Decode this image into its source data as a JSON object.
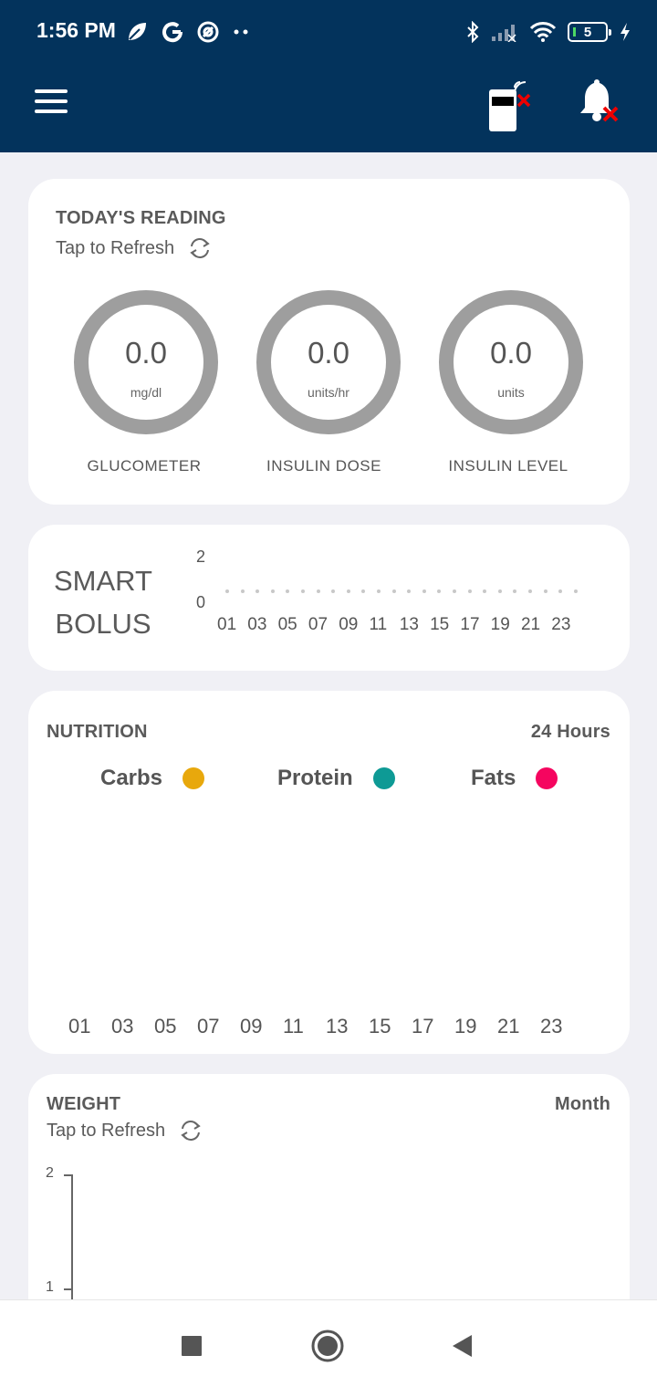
{
  "status_bar": {
    "time": "1:56 PM",
    "battery_level": "5",
    "icons_left": [
      "leaf-icon",
      "google-icon",
      "at-icon",
      "dots-icon"
    ],
    "icons_right": [
      "bluetooth-icon",
      "signal-icon",
      "wifi-icon",
      "battery-icon",
      "charging-icon"
    ]
  },
  "app_bar": {
    "icons": [
      "menu-icon",
      "device-disconnected-icon",
      "bell-off-icon"
    ]
  },
  "todays_reading": {
    "title": "TODAY'S READING",
    "refresh_label": "Tap to Refresh",
    "gauges": [
      {
        "value": "0.0",
        "unit": "mg/dl",
        "label": "GLUCOMETER"
      },
      {
        "value": "0.0",
        "unit": "units/hr",
        "label": "INSULIN DOSE"
      },
      {
        "value": "0.0",
        "unit": "units",
        "label": "INSULIN LEVEL"
      }
    ]
  },
  "smart_bolus": {
    "title_line1": "SMART",
    "title_line2": "BOLUS",
    "y_ticks": [
      "2",
      "0"
    ],
    "x_ticks": [
      "01",
      "03",
      "05",
      "07",
      "09",
      "11",
      "13",
      "15",
      "17",
      "19",
      "21",
      "23"
    ]
  },
  "nutrition": {
    "title": "NUTRITION",
    "range": "24 Hours",
    "legend": [
      {
        "label": "Carbs",
        "color": "#e8a80c"
      },
      {
        "label": "Protein",
        "color": "#0e9a95"
      },
      {
        "label": "Fats",
        "color": "#f5055f"
      }
    ],
    "x_ticks": [
      "01",
      "03",
      "05",
      "07",
      "09",
      "11",
      "13",
      "15",
      "17",
      "19",
      "21",
      "23"
    ]
  },
  "weight": {
    "title": "WEIGHT",
    "range": "Month",
    "refresh_label": "Tap to Refresh",
    "y_ticks": [
      "2",
      "1"
    ]
  },
  "colors": {
    "header": "#03335c",
    "gauge_ring": "#9e9e9e",
    "background": "#f0f0f5"
  },
  "nav_bar": {
    "buttons": [
      "recents-button",
      "home-button",
      "back-button"
    ]
  }
}
